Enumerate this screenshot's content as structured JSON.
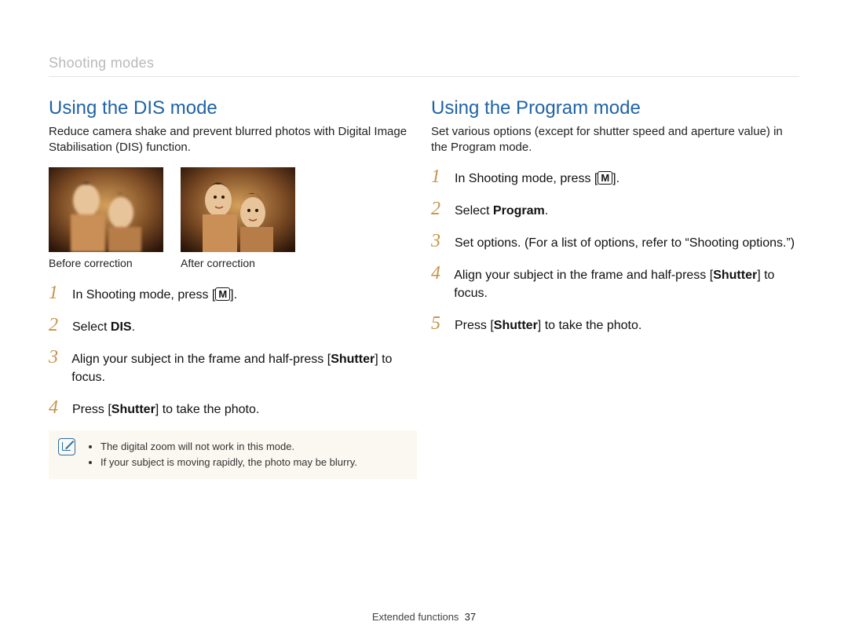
{
  "crumb": "Shooting modes",
  "left": {
    "title": "Using the DIS mode",
    "intro": "Reduce camera shake and prevent blurred photos with Digital Image Stabilisation (DIS) function.",
    "captions": {
      "before": "Before correction",
      "after": "After correction"
    },
    "steps": [
      {
        "n": "1",
        "pre": "In Shooting mode, press [",
        "icon": "M",
        "post": "]."
      },
      {
        "n": "2",
        "html": "Select <b>DIS</b>."
      },
      {
        "n": "3",
        "html": "Align your subject in the frame and half-press [<b>Shutter</b>] to focus."
      },
      {
        "n": "4",
        "html": "Press [<b>Shutter</b>] to take the photo."
      }
    ],
    "notes": [
      "The digital zoom will not work in this mode.",
      "If your subject is moving rapidly, the photo may be blurry."
    ]
  },
  "right": {
    "title": "Using the Program mode",
    "intro": "Set various options (except for shutter speed and aperture value) in the Program mode.",
    "steps": [
      {
        "n": "1",
        "pre": "In Shooting mode, press [",
        "icon": "M",
        "post": "]."
      },
      {
        "n": "2",
        "html": "Select <b>Program</b>."
      },
      {
        "n": "3",
        "html": "Set options. (For a list of options, refer to “Shooting options.”)"
      },
      {
        "n": "4",
        "html": "Align your subject in the frame and half-press [<b>Shutter</b>] to focus."
      },
      {
        "n": "5",
        "html": "Press [<b>Shutter</b>] to take the photo."
      }
    ]
  },
  "footer": {
    "section": "Extended functions",
    "page": "37"
  }
}
